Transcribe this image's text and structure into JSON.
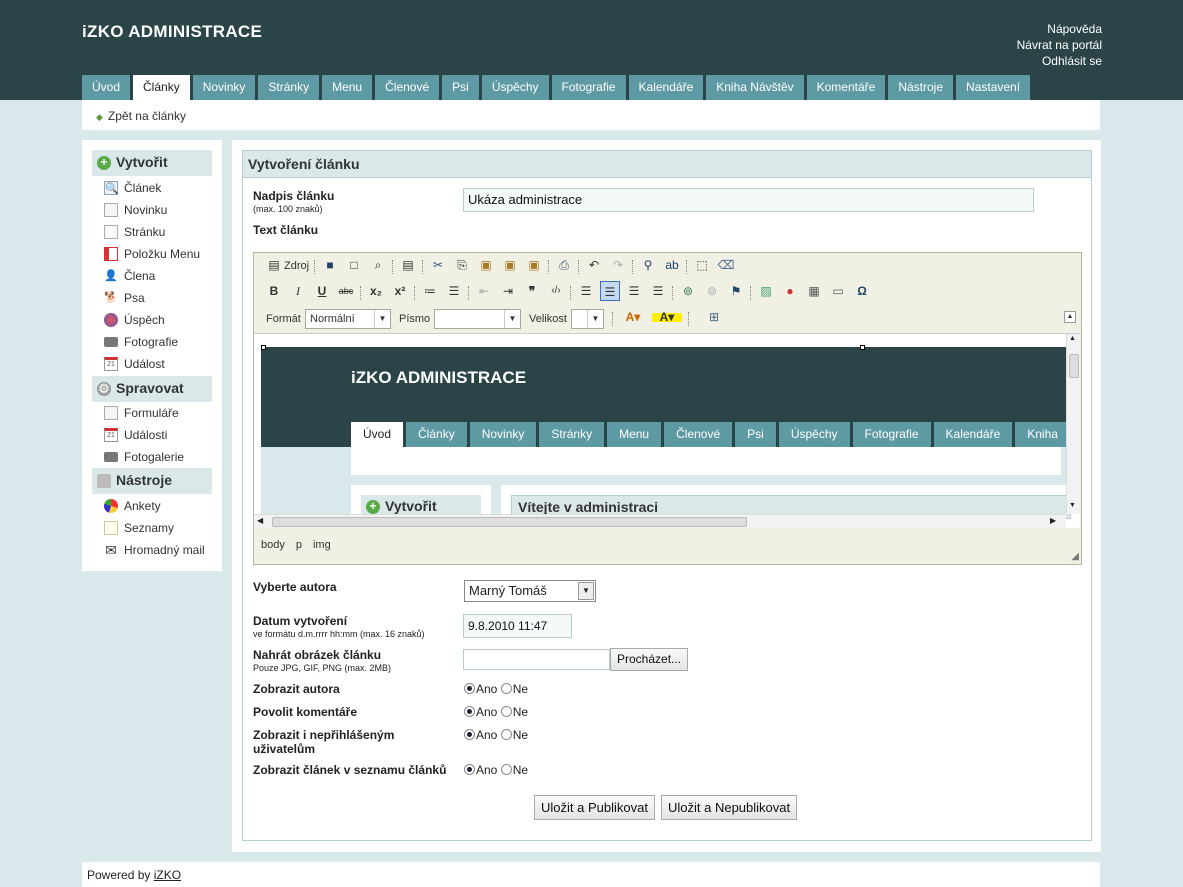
{
  "app": {
    "logo": "iZKO ADMINISTRACE"
  },
  "toplinks": [
    "Nápověda",
    "Návrat na portál",
    "Odhlásit se"
  ],
  "tabs": [
    "Úvod",
    "Články",
    "Novinky",
    "Stránky",
    "Menu",
    "Členové",
    "Psi",
    "Úspěchy",
    "Fotografie",
    "Kalendáře",
    "Kniha Návštěv",
    "Komentáře",
    "Nástroje",
    "Nastavení"
  ],
  "active_tab": "Články",
  "back_link": "Zpět na články",
  "sidebar": {
    "sections": [
      {
        "title": "Vytvořit",
        "icon": "plus-circle-icon",
        "items": [
          {
            "label": "Článek",
            "icon": "article-icon"
          },
          {
            "label": "Novinku",
            "icon": "news-icon"
          },
          {
            "label": "Stránku",
            "icon": "page-icon"
          },
          {
            "label": "Položku Menu",
            "icon": "menu-item-icon"
          },
          {
            "label": "Člena",
            "icon": "member-icon"
          },
          {
            "label": "Psa",
            "icon": "dog-icon"
          },
          {
            "label": "Úspěch",
            "icon": "success-icon"
          },
          {
            "label": "Fotografie",
            "icon": "camera-icon"
          },
          {
            "label": "Událost",
            "icon": "calendar-icon"
          }
        ]
      },
      {
        "title": "Spravovat",
        "icon": "gear-icon",
        "items": [
          {
            "label": "Formuláře",
            "icon": "form-icon"
          },
          {
            "label": "Události",
            "icon": "calendar-icon"
          },
          {
            "label": "Fotogalerie",
            "icon": "camera-icon"
          }
        ]
      },
      {
        "title": "Nástroje",
        "icon": "tools-box-icon",
        "items": [
          {
            "label": "Ankety",
            "icon": "pie-chart-icon"
          },
          {
            "label": "Seznamy",
            "icon": "list-icon"
          },
          {
            "label": "Hromadný mail",
            "icon": "mail-icon"
          }
        ]
      }
    ]
  },
  "form": {
    "title": "Vytvoření článku",
    "headline": {
      "label": "Nadpis článku",
      "hint": "(max. 100 znaků)",
      "value": "Ukáza administrace"
    },
    "text_label": "Text článku",
    "editor": {
      "source_label": "Zdroj",
      "format_label": "Formát",
      "format_value": "Normální",
      "font_label": "Písmo",
      "font_value": "",
      "size_label": "Velikost",
      "size_value": "",
      "path": [
        "body",
        "p",
        "img"
      ],
      "preview": {
        "logo": "iZKO ADMINISTRACE",
        "tabs": [
          "Úvod",
          "Články",
          "Novinky",
          "Stránky",
          "Menu",
          "Členové",
          "Psi",
          "Úspěchy",
          "Fotografie",
          "Kalendáře",
          "Kniha"
        ],
        "sidebar_title": "Vytvořit",
        "main_title": "Vítejte v administraci"
      }
    },
    "author": {
      "label": "Vyberte autora",
      "value": "Marný Tomáš"
    },
    "date": {
      "label": "Datum vytvoření",
      "hint": "ve formátu d.m.rrrr hh:mm (max. 16 znaků)",
      "value": "9.8.2010 11:47"
    },
    "image": {
      "label": "Nahrát obrázek článku",
      "hint": "Pouze JPG, GIF, PNG (max. 2MB)",
      "value": "",
      "browse": "Procházet..."
    },
    "radio_groups": [
      {
        "label": "Zobrazit autora",
        "yes": "Ano",
        "no": "Ne",
        "selected": "Ano"
      },
      {
        "label": "Povolit komentáře",
        "yes": "Ano",
        "no": "Ne",
        "selected": "Ano"
      },
      {
        "label": "Zobrazit i nepřihlášeným uživatelům",
        "yes": "Ano",
        "no": "Ne",
        "selected": "Ano"
      },
      {
        "label": "Zobrazit článek v seznamu článků",
        "yes": "Ano",
        "no": "Ne",
        "selected": "Ano"
      }
    ],
    "submit_publish": "Uložit a Publikovat",
    "submit_unpublish": "Uložit a Nepublikovat"
  },
  "footer": {
    "text": "Powered by ",
    "link": "iZKO"
  },
  "colors": {
    "header": "#2b4448",
    "tab": "#5e9aa3",
    "background": "#d9e8ea",
    "section": "#dae8ea"
  }
}
